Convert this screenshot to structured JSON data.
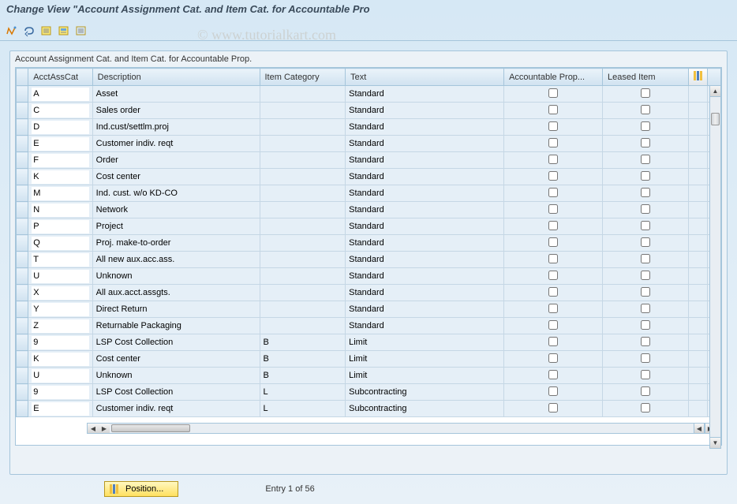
{
  "title": "Change View \"Account Assignment Cat. and Item Cat. for Accountable Pro",
  "watermark": "© www.tutorialkart.com",
  "panel_label": "Account Assignment Cat. and Item Cat. for Accountable Prop.",
  "columns": {
    "acct": "AcctAssCat",
    "desc": "Description",
    "itemcat": "Item Category",
    "text": "Text",
    "accp": "Accountable Prop...",
    "leased": "Leased Item"
  },
  "rows": [
    {
      "acct": "A",
      "desc": "Asset",
      "itemcat": "",
      "text": "Standard",
      "accp": false,
      "leased": false
    },
    {
      "acct": "C",
      "desc": "Sales order",
      "itemcat": "",
      "text": "Standard",
      "accp": false,
      "leased": false
    },
    {
      "acct": "D",
      "desc": "Ind.cust/settlm.proj",
      "itemcat": "",
      "text": "Standard",
      "accp": false,
      "leased": false
    },
    {
      "acct": "E",
      "desc": "Customer indiv. reqt",
      "itemcat": "",
      "text": "Standard",
      "accp": false,
      "leased": false
    },
    {
      "acct": "F",
      "desc": "Order",
      "itemcat": "",
      "text": "Standard",
      "accp": false,
      "leased": false
    },
    {
      "acct": "K",
      "desc": "Cost center",
      "itemcat": "",
      "text": "Standard",
      "accp": false,
      "leased": false
    },
    {
      "acct": "M",
      "desc": "Ind. cust. w/o KD-CO",
      "itemcat": "",
      "text": "Standard",
      "accp": false,
      "leased": false
    },
    {
      "acct": "N",
      "desc": "Network",
      "itemcat": "",
      "text": "Standard",
      "accp": false,
      "leased": false
    },
    {
      "acct": "P",
      "desc": "Project",
      "itemcat": "",
      "text": "Standard",
      "accp": false,
      "leased": false
    },
    {
      "acct": "Q",
      "desc": "Proj. make-to-order",
      "itemcat": "",
      "text": "Standard",
      "accp": false,
      "leased": false
    },
    {
      "acct": "T",
      "desc": "All new aux.acc.ass.",
      "itemcat": "",
      "text": "Standard",
      "accp": false,
      "leased": false
    },
    {
      "acct": "U",
      "desc": "Unknown",
      "itemcat": "",
      "text": "Standard",
      "accp": false,
      "leased": false
    },
    {
      "acct": "X",
      "desc": "All aux.acct.assgts.",
      "itemcat": "",
      "text": "Standard",
      "accp": false,
      "leased": false
    },
    {
      "acct": "Y",
      "desc": "Direct Return",
      "itemcat": "",
      "text": "Standard",
      "accp": false,
      "leased": false
    },
    {
      "acct": "Z",
      "desc": "Returnable Packaging",
      "itemcat": "",
      "text": "Standard",
      "accp": false,
      "leased": false
    },
    {
      "acct": "9",
      "desc": "LSP Cost Collection",
      "itemcat": "B",
      "text": "Limit",
      "accp": false,
      "leased": false
    },
    {
      "acct": "K",
      "desc": "Cost center",
      "itemcat": "B",
      "text": "Limit",
      "accp": false,
      "leased": false
    },
    {
      "acct": "U",
      "desc": "Unknown",
      "itemcat": "B",
      "text": "Limit",
      "accp": false,
      "leased": false
    },
    {
      "acct": "9",
      "desc": "LSP Cost Collection",
      "itemcat": "L",
      "text": "Subcontracting",
      "accp": false,
      "leased": false
    },
    {
      "acct": "E",
      "desc": "Customer indiv. reqt",
      "itemcat": "L",
      "text": "Subcontracting",
      "accp": false,
      "leased": false
    }
  ],
  "footer": {
    "position_label": "Position...",
    "entry_text": "Entry 1 of 56"
  }
}
